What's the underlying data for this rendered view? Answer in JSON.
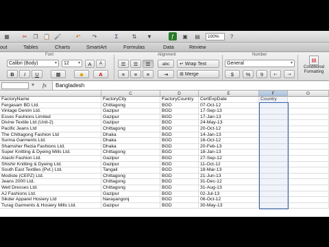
{
  "ribbon_tabs": [
    "out",
    "Tables",
    "Charts",
    "SmartArt",
    "Formulas",
    "Data",
    "Review"
  ],
  "toolbar": {
    "zoom": "100%"
  },
  "ribbon": {
    "font_group_label": "Font",
    "alignment_group_label": "Alignment",
    "number_group_label": "Number",
    "font_name": "Calibri (Body)",
    "font_size": "12",
    "bold": "B",
    "italic": "I",
    "underline": "U",
    "abc": "abc",
    "wrap_text": "Wrap Text",
    "merge": "Merge",
    "number_format": "General",
    "percent": "%",
    "comma": "9",
    "conditional_formatting": "Conditional Formatting"
  },
  "formula_bar": {
    "fx": "fx",
    "value": "Bangladesh"
  },
  "grid": {
    "columns": [
      "C",
      "D",
      "E",
      "F",
      "G"
    ],
    "headers": [
      "FactoryName",
      "FactoryCity",
      "FactoryCountry",
      "CertExpDate",
      "Country"
    ],
    "rows": [
      [
        "Fergasam BD Ltd.",
        "Chittagong",
        "BGD",
        "07-Oct-12"
      ],
      [
        "Vintage Denim Ltd.",
        "Gazipur",
        "BGD",
        "17-Sep-13"
      ],
      [
        "Esses Fashions Limited",
        "Gazipur",
        "BGD",
        "17-Jan-13"
      ],
      [
        "Divine Textile Ltd (Unit-2)",
        "Gazipur",
        "BGD",
        "24-May-13"
      ],
      [
        "Pacific Jeans Ltd",
        "Chittagong",
        "BGD",
        "20-Oct-12"
      ],
      [
        "The Chittagong Fashion Ltd",
        "Dhaka",
        "BGD",
        "14-Jan-13"
      ],
      [
        "Surma Garments Ltd.",
        "Dhaka",
        "BGD",
        "16-Oct-12"
      ],
      [
        "Shamsher Rezia Fashions Ltd.",
        "Dhaka",
        "BGD",
        "20-Feb-13"
      ],
      [
        "Super Knitting & Dyeing Mills Ltd.",
        "Chittagong",
        "BGD",
        "18-Jan-13"
      ],
      [
        "Atashi Fashion Ltd.",
        "Gazipur",
        "BGD",
        "27-Sep-12"
      ],
      [
        "Shishir Knitting & Dyeing Ltd.",
        "Gazipur",
        "BGD",
        "11-Oct-12"
      ],
      [
        "South East Textiles (Pvt.) Ltd.",
        "Tangail",
        "BGD",
        "18-Mar-13"
      ],
      [
        "Modiste (CEPZ) Ltd.",
        "Chittagong",
        "BGD",
        "21-Jun-13"
      ],
      [
        "Jeans 2000 Ltd.",
        "Chittagong",
        "BGD",
        "31-Dec-12"
      ],
      [
        "Well Dresses Ltd.",
        "Chittagong",
        "BGD",
        "31-Aug-13"
      ],
      [
        "AJ Fashions Ltd.",
        "Gazipur",
        "BGD",
        "02-Jul-13"
      ],
      [
        "Sikder Apparel Hosiery Ltd",
        "Narayangonj",
        "BGD",
        "06-Oct-12"
      ],
      [
        "Turag Garments & Hosiery Mills Ltd.",
        "Gazipur",
        "BGD",
        "30-May-13"
      ]
    ]
  }
}
